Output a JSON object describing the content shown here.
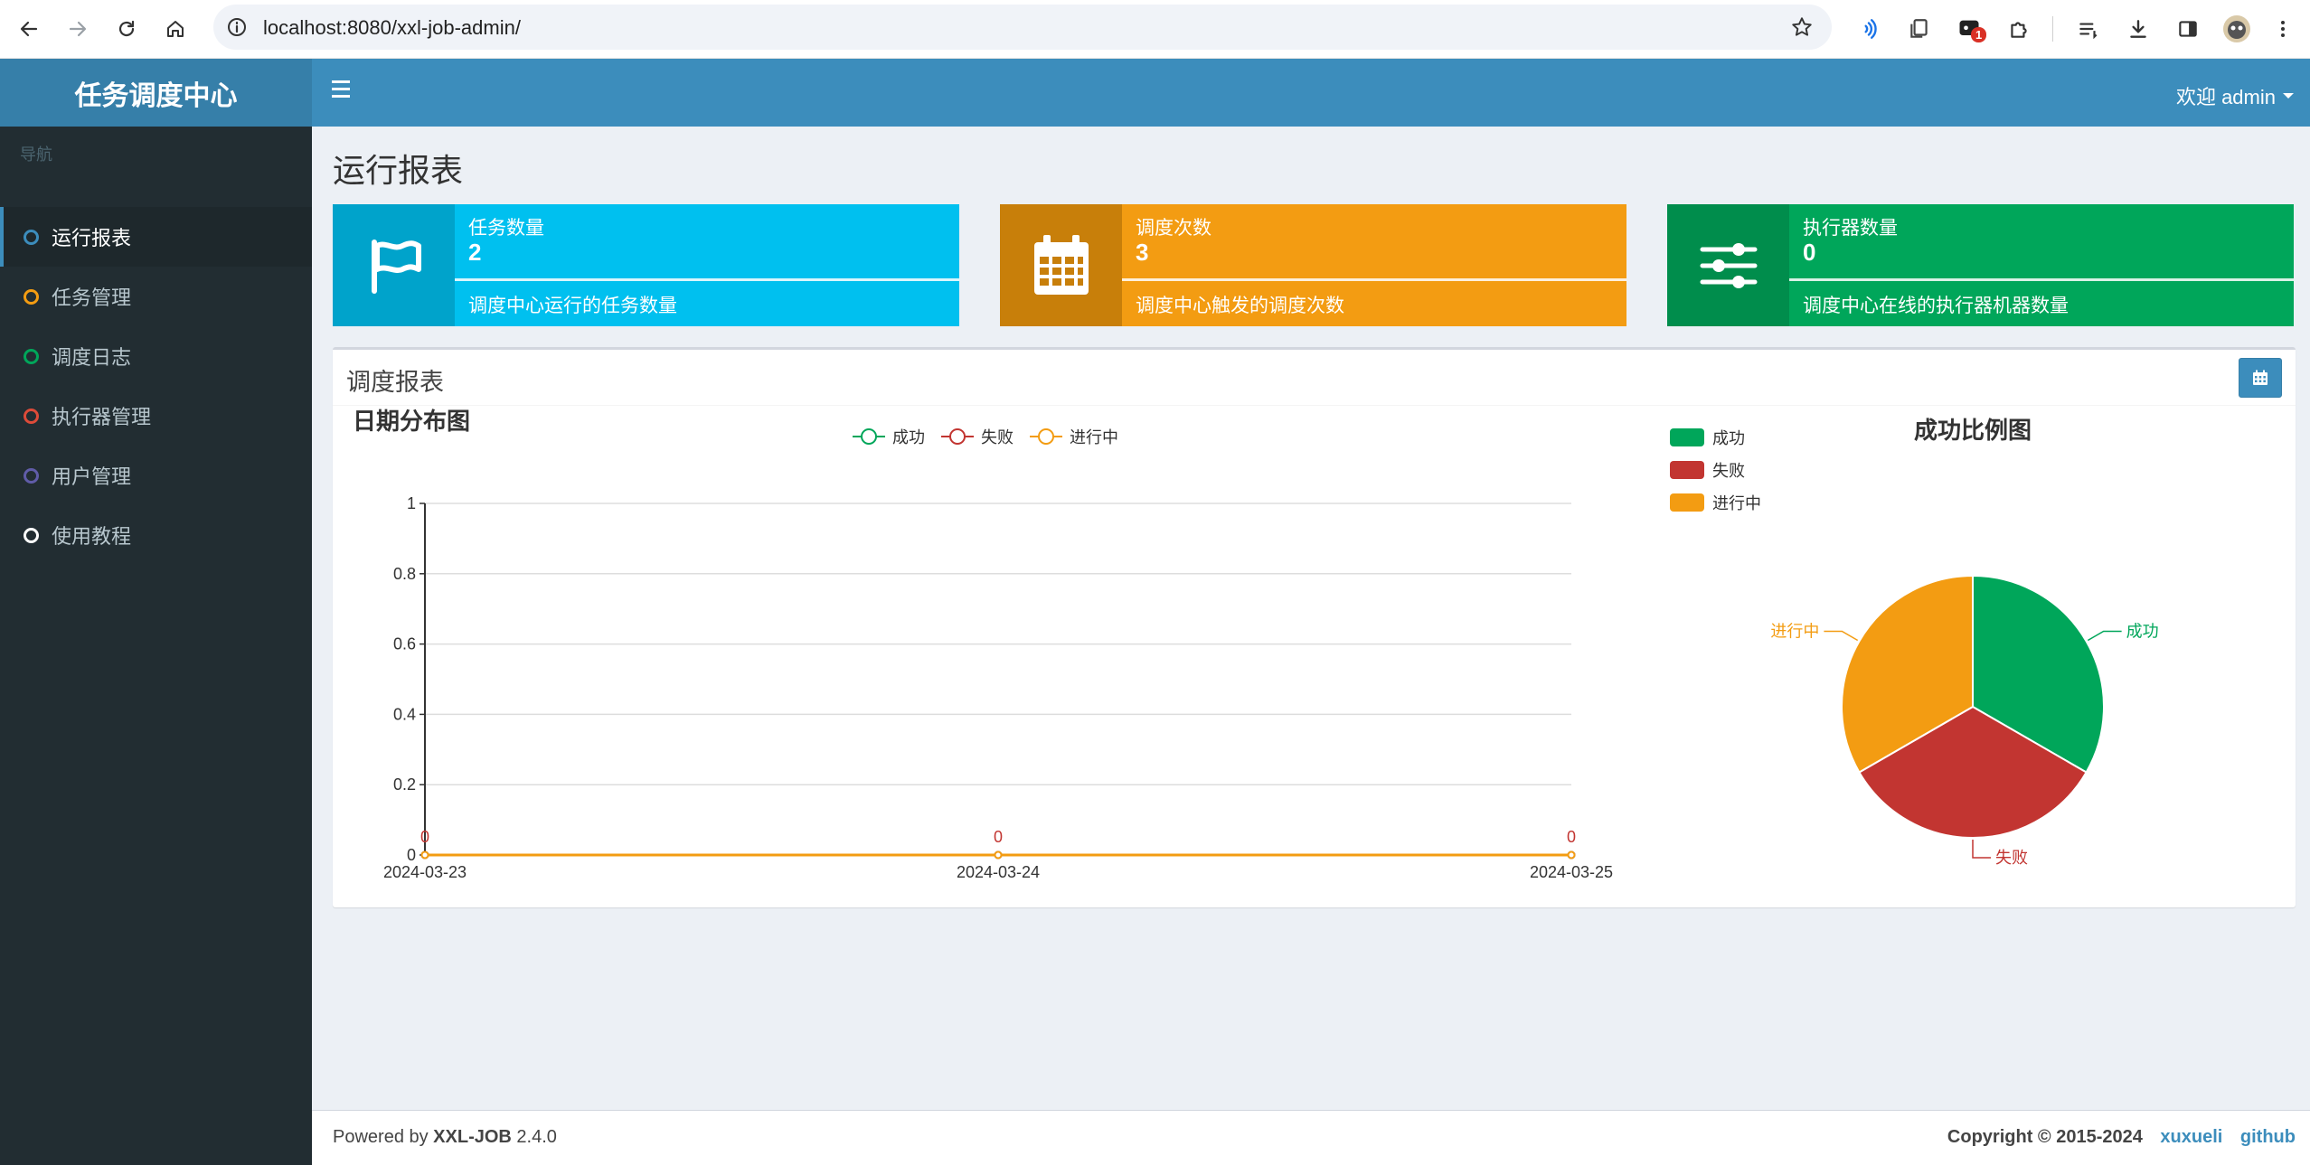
{
  "browser": {
    "url": "localhost:8080/xxl-job-admin/",
    "extension_badge": "1"
  },
  "sidebar": {
    "logo": "任务调度中心",
    "header": "导航",
    "items": [
      {
        "label": "运行报表",
        "color": "#3c8dbc",
        "active": true
      },
      {
        "label": "任务管理",
        "color": "#f39c12"
      },
      {
        "label": "调度日志",
        "color": "#00a65a"
      },
      {
        "label": "执行器管理",
        "color": "#dd4b39"
      },
      {
        "label": "用户管理",
        "color": "#605ca8"
      },
      {
        "label": "使用教程",
        "color": "#ffffff"
      }
    ]
  },
  "header": {
    "welcome": "欢迎 admin"
  },
  "page": {
    "title": "运行报表"
  },
  "info_boxes": [
    {
      "label": "任务数量",
      "number": "2",
      "desc": "调度中心运行的任务数量",
      "color": "#00c0ef",
      "icon_bg": "#00a3cb",
      "icon": "flag-icon"
    },
    {
      "label": "调度次数",
      "number": "3",
      "desc": "调度中心触发的调度次数",
      "color": "#f39c12",
      "icon_bg": "#c87f0a",
      "icon": "calendar-icon"
    },
    {
      "label": "执行器数量",
      "number": "0",
      "desc": "调度中心在线的执行器机器数量",
      "color": "#00a65a",
      "icon_bg": "#008d4c",
      "icon": "sliders-icon"
    }
  ],
  "report": {
    "title": "调度报表"
  },
  "chart_data": [
    {
      "type": "line",
      "title": "日期分布图",
      "x": [
        "2024-03-23",
        "2024-03-24",
        "2024-03-25"
      ],
      "yticks": [
        "0",
        "0.2",
        "0.4",
        "0.6",
        "0.8",
        "1"
      ],
      "ylim": [
        0,
        1
      ],
      "legend_position": "top-center",
      "series": [
        {
          "name": "成功",
          "color": "#00a65a",
          "values": [
            0,
            0,
            0
          ]
        },
        {
          "name": "失败",
          "color": "#c23531",
          "values": [
            0,
            0,
            0
          ]
        },
        {
          "name": "进行中",
          "color": "#f39c12",
          "values": [
            0,
            0,
            0
          ]
        }
      ],
      "data_labels": [
        "0",
        "0",
        "0"
      ]
    },
    {
      "type": "pie",
      "title": "成功比例图",
      "legend_position": "top-left",
      "slices": [
        {
          "name": "成功",
          "color": "#00a65a",
          "value": 1
        },
        {
          "name": "失败",
          "color": "#c23531",
          "value": 1
        },
        {
          "name": "进行中",
          "color": "#f39c12",
          "value": 1
        }
      ]
    }
  ],
  "footer": {
    "powered_prefix": "Powered by ",
    "powered_brand": "XXL-JOB",
    "version": " 2.4.0",
    "copyright": "Copyright © 2015-2024",
    "link1": "xuxueli",
    "link2": "github"
  }
}
